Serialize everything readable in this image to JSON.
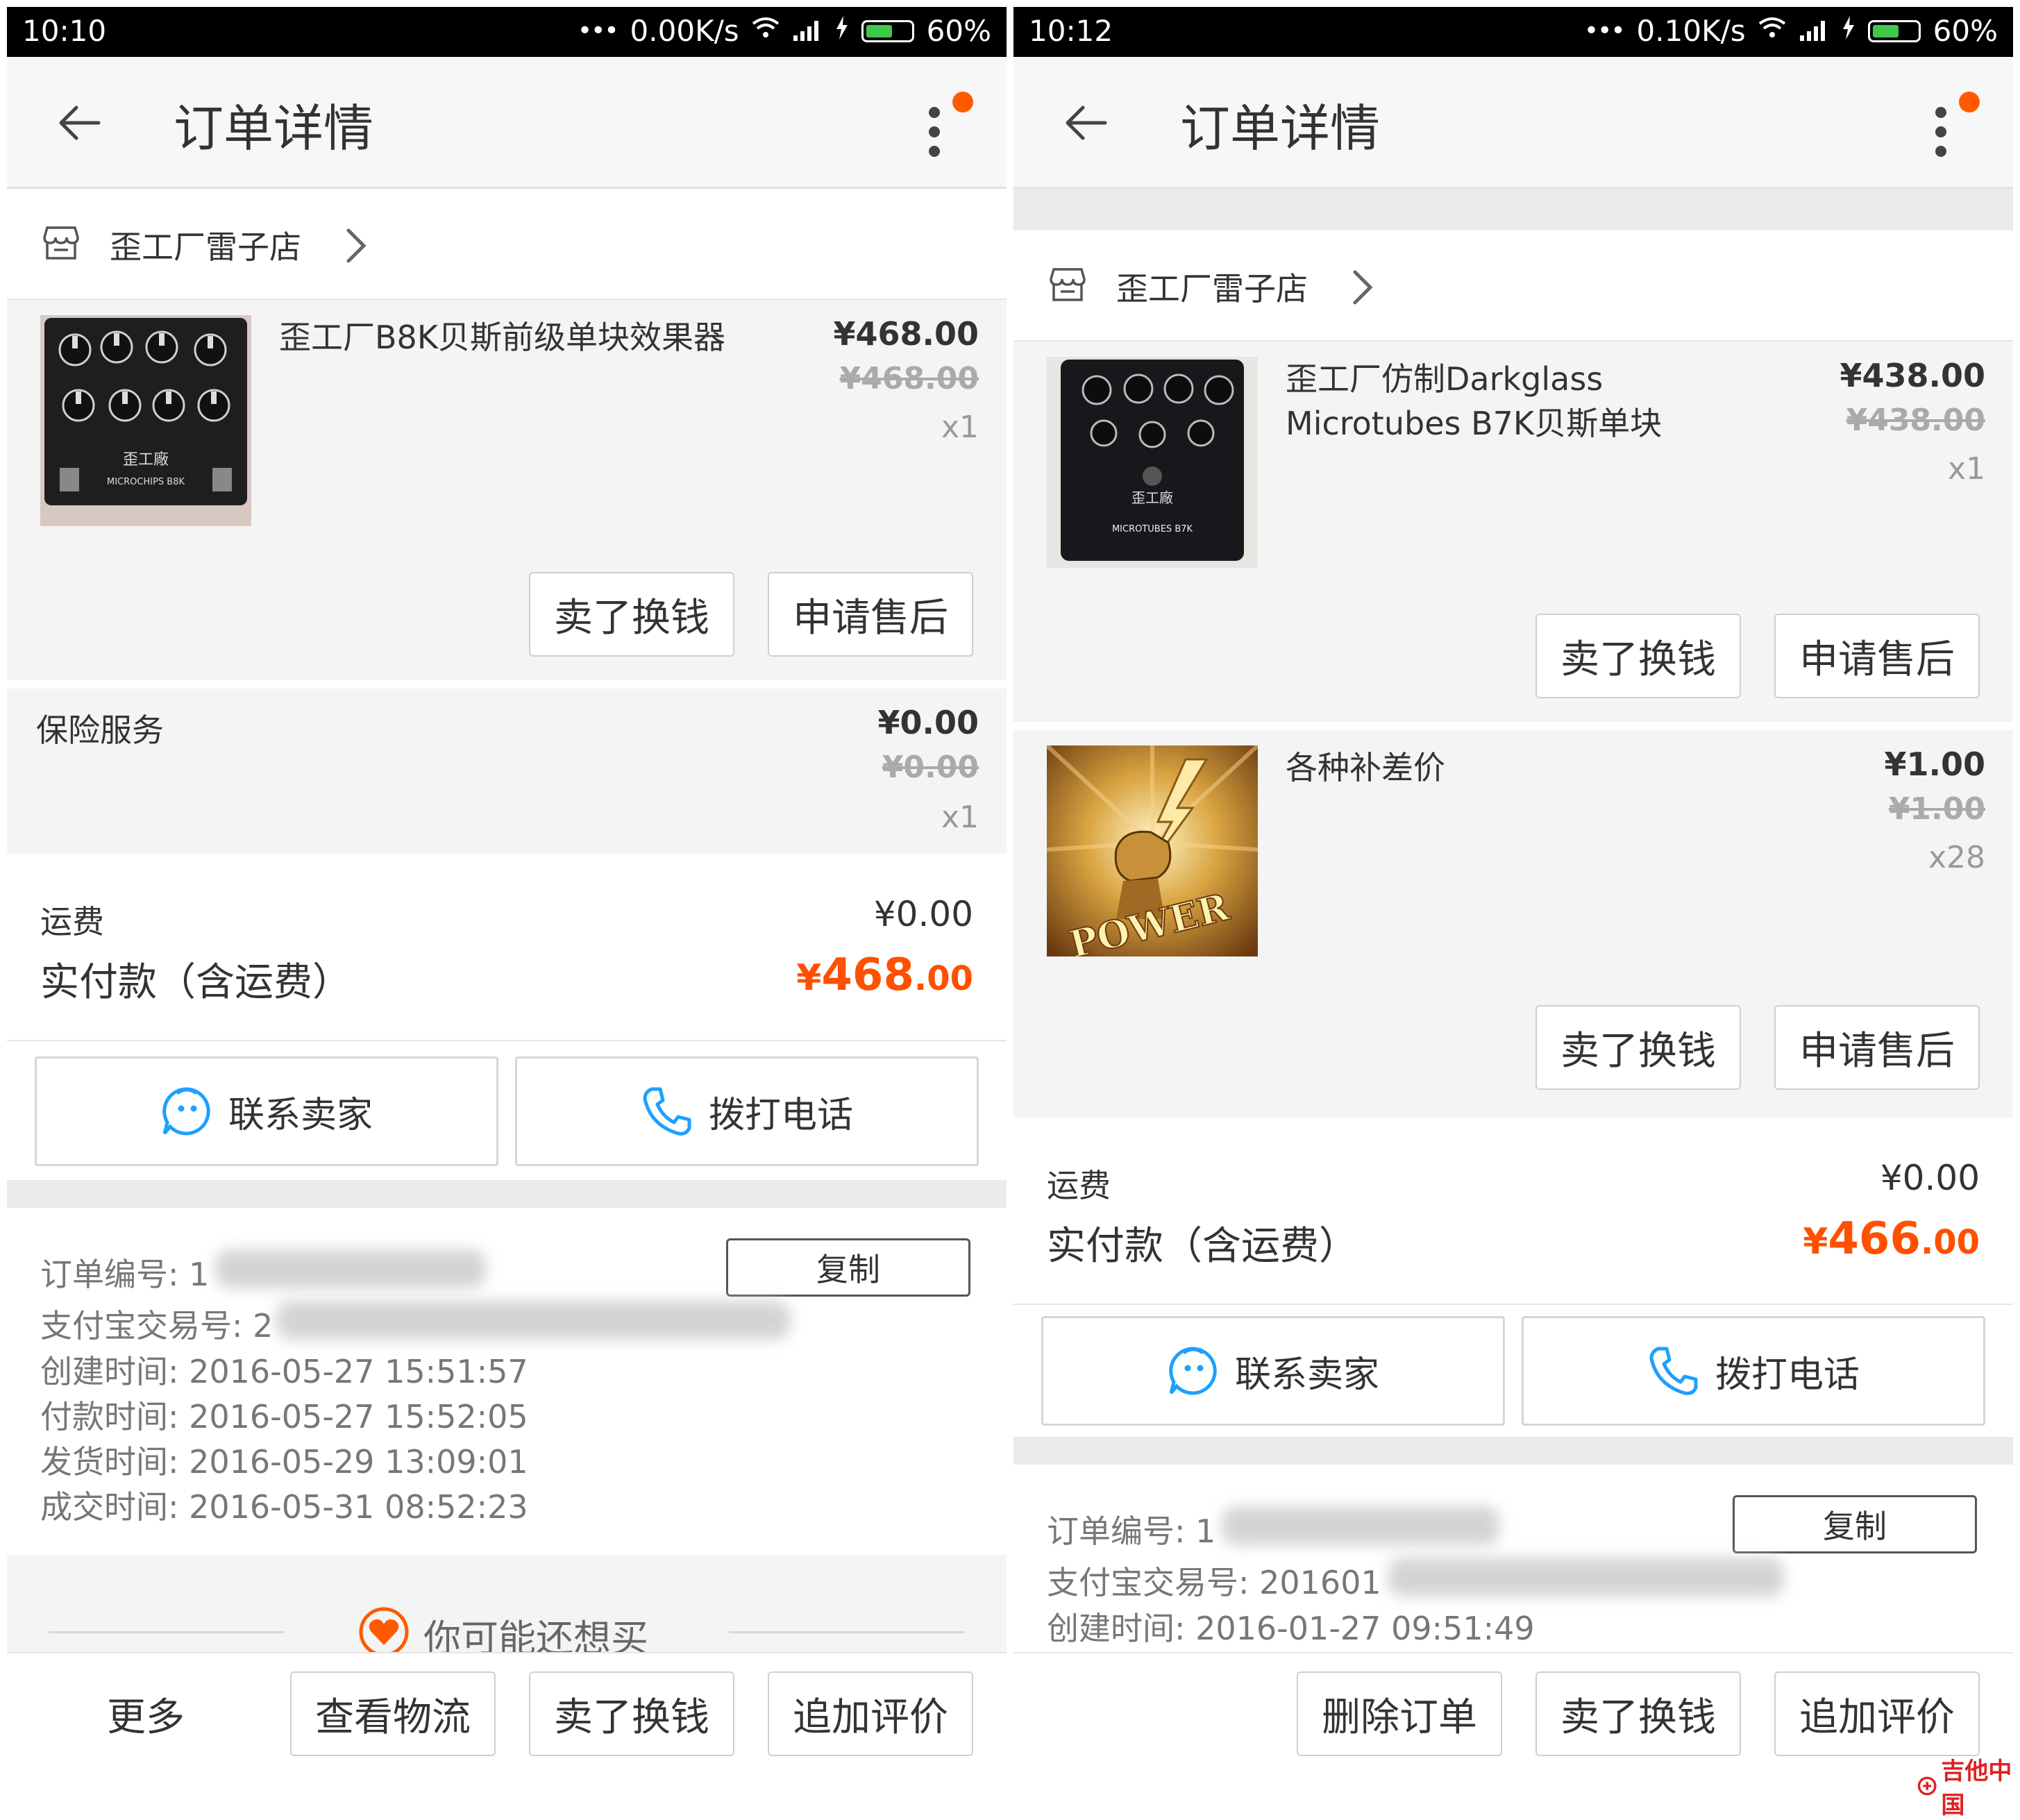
{
  "left": {
    "status": {
      "time": "10:10",
      "dots": "•••",
      "speed": "0.00K/s",
      "battery": "60%",
      "battery_level": 0.6
    },
    "nav": {
      "title": "订单详情"
    },
    "shop": {
      "name": "歪工厂雷子店"
    },
    "item1": {
      "title": "歪工厂B8K贝斯前级单块效果器",
      "price": "¥468.00",
      "price_old": "¥468.00",
      "qty": "x1",
      "thumb_text": "MICROCHIPS B8K",
      "thumb_script": "歪工廠"
    },
    "item_actions": {
      "sell": "卖了换钱",
      "after_sale": "申请售后"
    },
    "insurance": {
      "label": "保险服务",
      "price": "¥0.00",
      "price_old": "¥0.00",
      "qty": "x1"
    },
    "summary": {
      "shipping_label": "运费",
      "shipping_value": "¥0.00",
      "total_label": "实付款（含运费）",
      "total_symbol": "¥",
      "total_int": "468",
      "total_dec": ".00"
    },
    "contact": {
      "chat": "联系卖家",
      "call": "拨打电话"
    },
    "info": {
      "order_no_label": "订单编号: ",
      "order_no_visible": "1",
      "copy": "复制",
      "alipay_label": "支付宝交易号: ",
      "alipay_visible": "2",
      "created": "创建时间: 2016-05-27 15:51:57",
      "paid": "付款时间: 2016-05-27 15:52:05",
      "shipped": "发货时间: 2016-05-29 13:09:01",
      "closed": "成交时间: 2016-05-31 08:52:23"
    },
    "recommend": {
      "text": "你可能还想买"
    },
    "bottom": {
      "more": "更多",
      "logistics": "查看物流",
      "sell": "卖了换钱",
      "review": "追加评价"
    }
  },
  "right": {
    "status": {
      "time": "10:12",
      "dots": "•••",
      "speed": "0.10K/s",
      "battery": "60%",
      "battery_level": 0.6
    },
    "nav": {
      "title": "订单详情"
    },
    "shop": {
      "name": "歪工厂雷子店"
    },
    "item1": {
      "title": "歪工厂仿制Darkglass Microtubes B7K贝斯单块",
      "price": "¥438.00",
      "price_old": "¥438.00",
      "qty": "x1",
      "thumb_text": "MICROTUBES B7K",
      "thumb_script": "歪工廠"
    },
    "item2": {
      "title": "各种补差价",
      "price": "¥1.00",
      "price_old": "¥1.00",
      "qty": "x28",
      "thumb_text": "POWER"
    },
    "item_actions": {
      "sell": "卖了换钱",
      "after_sale": "申请售后"
    },
    "summary": {
      "shipping_label": "运费",
      "shipping_value": "¥0.00",
      "total_label": "实付款（含运费）",
      "total_symbol": "¥",
      "total_int": "466",
      "total_dec": ".00"
    },
    "contact": {
      "chat": "联系卖家",
      "call": "拨打电话"
    },
    "info": {
      "order_no_label": "订单编号: ",
      "order_no_visible": "1",
      "copy": "复制",
      "alipay_label": "支付宝交易号: ",
      "alipay_visible": "201601",
      "created": "创建时间: 2016-01-27 09:51:49"
    },
    "bottom": {
      "delete": "删除订单",
      "sell": "卖了换钱",
      "review": "追加评价"
    }
  },
  "watermark": {
    "text": "吉他中国"
  },
  "colors": {
    "accent": "#ff5000",
    "badge": "#ff5a00",
    "icon_blue": "#1ea0ff",
    "battery": "#3ec94a"
  }
}
